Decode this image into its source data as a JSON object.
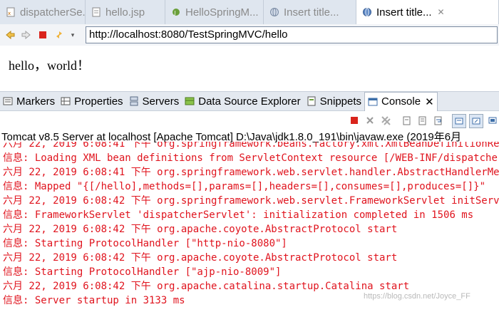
{
  "editor_tabs": [
    {
      "label": "dispatcherSe...",
      "icon": "xml-file-icon",
      "active": false
    },
    {
      "label": "hello.jsp",
      "icon": "jsp-file-icon",
      "active": false
    },
    {
      "label": "HelloSpringM...",
      "icon": "java-file-icon",
      "active": false
    },
    {
      "label": "Insert title...",
      "icon": "web-browser-icon",
      "active": false
    },
    {
      "label": "Insert title...",
      "icon": "web-browser-icon",
      "active": true,
      "close": "✕"
    }
  ],
  "browser": {
    "url": "http://localhost:8080/TestSpringMVC/hello",
    "content": "hello，world！"
  },
  "view_tabs": [
    {
      "label": "Markers",
      "icon": "markers-icon"
    },
    {
      "label": "Properties",
      "icon": "properties-icon"
    },
    {
      "label": "Servers",
      "icon": "servers-icon"
    },
    {
      "label": "Data Source Explorer",
      "icon": "data-source-icon"
    },
    {
      "label": "Snippets",
      "icon": "snippets-icon"
    },
    {
      "label": "Console",
      "icon": "console-icon",
      "active": true,
      "close": "✕"
    }
  ],
  "console": {
    "process": "Tomcat v8.5 Server at localhost [Apache Tomcat] D:\\Java\\jdk1.8.0_191\\bin\\javaw.exe (2019年6月",
    "lines": [
      "六月 22, 2019 6:08:41 下午 org.springframework.beans.factory.xml.XmlBeanDefinitionReader",
      "信息: Loading XML bean definitions from ServletContext resource [/WEB-INF/dispatcherServlet-servlet.xml]",
      "六月 22, 2019 6:08:41 下午 org.springframework.web.servlet.handler.AbstractHandlerMethodMapping",
      "信息: Mapped \"{[/hello],methods=[],params=[],headers=[],consumes=[],produces=[]}\"",
      "六月 22, 2019 6:08:42 下午 org.springframework.web.servlet.FrameworkServlet initServletBean",
      "信息: FrameworkServlet 'dispatcherServlet': initialization completed in 1506 ms",
      "六月 22, 2019 6:08:42 下午 org.apache.coyote.AbstractProtocol start",
      "信息: Starting ProtocolHandler [\"http-nio-8080\"]",
      "六月 22, 2019 6:08:42 下午 org.apache.coyote.AbstractProtocol start",
      "信息: Starting ProtocolHandler [\"ajp-nio-8009\"]",
      "六月 22, 2019 6:08:42 下午 org.apache.catalina.startup.Catalina start",
      "信息: Server startup in 3133 ms"
    ],
    "text_color": "#e0141e"
  },
  "watermark": "https://blog.csdn.net/Joyce_FF",
  "colors": {
    "accent": "#3c6ea8",
    "stop_red": "#d9241c"
  }
}
